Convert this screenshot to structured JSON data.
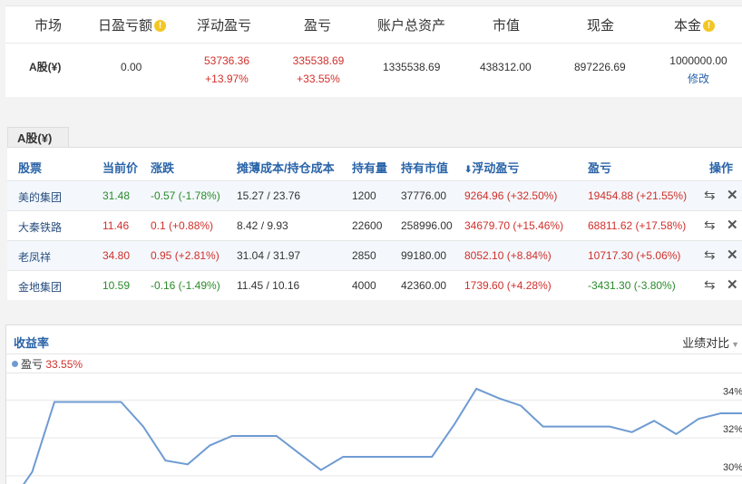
{
  "summary": {
    "headers": [
      "市场",
      "日盈亏额",
      "浮动盈亏",
      "盈亏",
      "账户总资产",
      "市值",
      "现金",
      "本金"
    ],
    "market": "A股(¥)",
    "daily_pnl": "0.00",
    "floating_pnl": "53736.36",
    "floating_pnl_pct": "+13.97%",
    "pnl": "335538.69",
    "pnl_pct": "+33.55%",
    "total_assets": "1335538.69",
    "market_value": "438312.00",
    "cash": "897226.69",
    "principal": "1000000.00",
    "modify_label": "修改",
    "info_icon_glyph": "!"
  },
  "holdings": {
    "tab_label": "A股(¥)",
    "columns": [
      "股票",
      "当前价",
      "涨跌",
      "摊薄成本/持仓成本",
      "持有量",
      "持有市值",
      "浮动盈亏",
      "盈亏",
      "操作"
    ],
    "sort_icon": "sort-down-arrow",
    "rows": [
      {
        "name": "美的集团",
        "price": "31.48",
        "change": "-0.57 (-1.78%)",
        "cost": "15.27 / 23.76",
        "qty": "1200",
        "value": "37776.00",
        "float_pnl": "9264.96 (+32.50%)",
        "pnl": "19454.88 (+21.55%)",
        "price_dir": "down",
        "change_dir": "down",
        "float_dir": "up",
        "pnl_dir": "up"
      },
      {
        "name": "大秦铁路",
        "price": "11.46",
        "change": "0.1 (+0.88%)",
        "cost": "8.42 / 9.93",
        "qty": "22600",
        "value": "258996.00",
        "float_pnl": "34679.70 (+15.46%)",
        "pnl": "68811.62 (+17.58%)",
        "price_dir": "up",
        "change_dir": "up",
        "float_dir": "up",
        "pnl_dir": "up"
      },
      {
        "name": "老凤祥",
        "price": "34.80",
        "change": "0.95 (+2.81%)",
        "cost": "31.04 / 31.97",
        "qty": "2850",
        "value": "99180.00",
        "float_pnl": "8052.10 (+8.84%)",
        "pnl": "10717.30 (+5.06%)",
        "price_dir": "up",
        "change_dir": "up",
        "float_dir": "up",
        "pnl_dir": "up"
      },
      {
        "name": "金地集团",
        "price": "10.59",
        "change": "-0.16 (-1.49%)",
        "cost": "11.45 / 10.16",
        "qty": "4000",
        "value": "42360.00",
        "float_pnl": "1739.60 (+4.28%)",
        "pnl": "-3431.30 (-3.80%)",
        "price_dir": "down",
        "change_dir": "down",
        "float_dir": "up",
        "pnl_dir": "down"
      }
    ],
    "action_icons": [
      "transfer-icon",
      "delete-icon"
    ]
  },
  "chart": {
    "title": "收益率",
    "action_label": "业绩对比",
    "legend_name": "盈亏",
    "legend_value": "33.55%",
    "colors": {
      "line": "#6f9bd2",
      "up": "#d0302b",
      "down": "#2a8a2a",
      "link": "#2a64a8"
    }
  },
  "chart_data": {
    "type": "line",
    "series": [
      {
        "name": "盈亏",
        "values": [
          28.5,
          30.2,
          33.9,
          33.9,
          33.9,
          33.9,
          32.6,
          30.8,
          30.6,
          31.6,
          32.1,
          32.1,
          32.1,
          31.2,
          30.3,
          31.0,
          31.0,
          31.0,
          31.0,
          31.0,
          32.7,
          34.6,
          34.1,
          33.7,
          32.6,
          32.6,
          32.6,
          32.6,
          32.3,
          32.9,
          32.2,
          33.0,
          33.3,
          33.3
        ]
      }
    ],
    "y_ticks": [
      "34%",
      "32%",
      "30%"
    ],
    "y_tick_values": [
      34,
      32,
      30
    ],
    "ylim": [
      29.8,
      35.6
    ],
    "grid": true
  }
}
